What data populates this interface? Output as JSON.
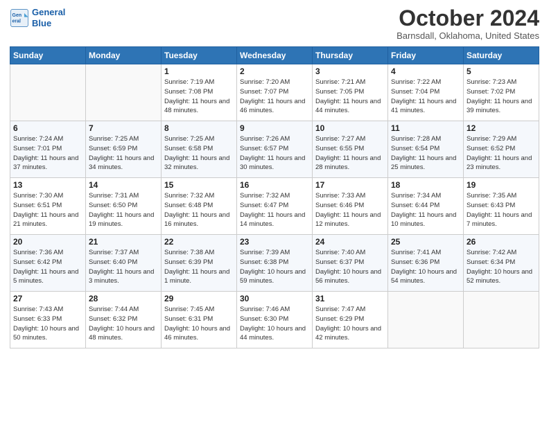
{
  "header": {
    "logo_line1": "General",
    "logo_line2": "Blue",
    "month_title": "October 2024",
    "location": "Barnsdall, Oklahoma, United States"
  },
  "days_of_week": [
    "Sunday",
    "Monday",
    "Tuesday",
    "Wednesday",
    "Thursday",
    "Friday",
    "Saturday"
  ],
  "weeks": [
    [
      {
        "day": "",
        "info": ""
      },
      {
        "day": "",
        "info": ""
      },
      {
        "day": "1",
        "info": "Sunrise: 7:19 AM\nSunset: 7:08 PM\nDaylight: 11 hours and 48 minutes."
      },
      {
        "day": "2",
        "info": "Sunrise: 7:20 AM\nSunset: 7:07 PM\nDaylight: 11 hours and 46 minutes."
      },
      {
        "day": "3",
        "info": "Sunrise: 7:21 AM\nSunset: 7:05 PM\nDaylight: 11 hours and 44 minutes."
      },
      {
        "day": "4",
        "info": "Sunrise: 7:22 AM\nSunset: 7:04 PM\nDaylight: 11 hours and 41 minutes."
      },
      {
        "day": "5",
        "info": "Sunrise: 7:23 AM\nSunset: 7:02 PM\nDaylight: 11 hours and 39 minutes."
      }
    ],
    [
      {
        "day": "6",
        "info": "Sunrise: 7:24 AM\nSunset: 7:01 PM\nDaylight: 11 hours and 37 minutes."
      },
      {
        "day": "7",
        "info": "Sunrise: 7:25 AM\nSunset: 6:59 PM\nDaylight: 11 hours and 34 minutes."
      },
      {
        "day": "8",
        "info": "Sunrise: 7:25 AM\nSunset: 6:58 PM\nDaylight: 11 hours and 32 minutes."
      },
      {
        "day": "9",
        "info": "Sunrise: 7:26 AM\nSunset: 6:57 PM\nDaylight: 11 hours and 30 minutes."
      },
      {
        "day": "10",
        "info": "Sunrise: 7:27 AM\nSunset: 6:55 PM\nDaylight: 11 hours and 28 minutes."
      },
      {
        "day": "11",
        "info": "Sunrise: 7:28 AM\nSunset: 6:54 PM\nDaylight: 11 hours and 25 minutes."
      },
      {
        "day": "12",
        "info": "Sunrise: 7:29 AM\nSunset: 6:52 PM\nDaylight: 11 hours and 23 minutes."
      }
    ],
    [
      {
        "day": "13",
        "info": "Sunrise: 7:30 AM\nSunset: 6:51 PM\nDaylight: 11 hours and 21 minutes."
      },
      {
        "day": "14",
        "info": "Sunrise: 7:31 AM\nSunset: 6:50 PM\nDaylight: 11 hours and 19 minutes."
      },
      {
        "day": "15",
        "info": "Sunrise: 7:32 AM\nSunset: 6:48 PM\nDaylight: 11 hours and 16 minutes."
      },
      {
        "day": "16",
        "info": "Sunrise: 7:32 AM\nSunset: 6:47 PM\nDaylight: 11 hours and 14 minutes."
      },
      {
        "day": "17",
        "info": "Sunrise: 7:33 AM\nSunset: 6:46 PM\nDaylight: 11 hours and 12 minutes."
      },
      {
        "day": "18",
        "info": "Sunrise: 7:34 AM\nSunset: 6:44 PM\nDaylight: 11 hours and 10 minutes."
      },
      {
        "day": "19",
        "info": "Sunrise: 7:35 AM\nSunset: 6:43 PM\nDaylight: 11 hours and 7 minutes."
      }
    ],
    [
      {
        "day": "20",
        "info": "Sunrise: 7:36 AM\nSunset: 6:42 PM\nDaylight: 11 hours and 5 minutes."
      },
      {
        "day": "21",
        "info": "Sunrise: 7:37 AM\nSunset: 6:40 PM\nDaylight: 11 hours and 3 minutes."
      },
      {
        "day": "22",
        "info": "Sunrise: 7:38 AM\nSunset: 6:39 PM\nDaylight: 11 hours and 1 minute."
      },
      {
        "day": "23",
        "info": "Sunrise: 7:39 AM\nSunset: 6:38 PM\nDaylight: 10 hours and 59 minutes."
      },
      {
        "day": "24",
        "info": "Sunrise: 7:40 AM\nSunset: 6:37 PM\nDaylight: 10 hours and 56 minutes."
      },
      {
        "day": "25",
        "info": "Sunrise: 7:41 AM\nSunset: 6:36 PM\nDaylight: 10 hours and 54 minutes."
      },
      {
        "day": "26",
        "info": "Sunrise: 7:42 AM\nSunset: 6:34 PM\nDaylight: 10 hours and 52 minutes."
      }
    ],
    [
      {
        "day": "27",
        "info": "Sunrise: 7:43 AM\nSunset: 6:33 PM\nDaylight: 10 hours and 50 minutes."
      },
      {
        "day": "28",
        "info": "Sunrise: 7:44 AM\nSunset: 6:32 PM\nDaylight: 10 hours and 48 minutes."
      },
      {
        "day": "29",
        "info": "Sunrise: 7:45 AM\nSunset: 6:31 PM\nDaylight: 10 hours and 46 minutes."
      },
      {
        "day": "30",
        "info": "Sunrise: 7:46 AM\nSunset: 6:30 PM\nDaylight: 10 hours and 44 minutes."
      },
      {
        "day": "31",
        "info": "Sunrise: 7:47 AM\nSunset: 6:29 PM\nDaylight: 10 hours and 42 minutes."
      },
      {
        "day": "",
        "info": ""
      },
      {
        "day": "",
        "info": ""
      }
    ]
  ]
}
